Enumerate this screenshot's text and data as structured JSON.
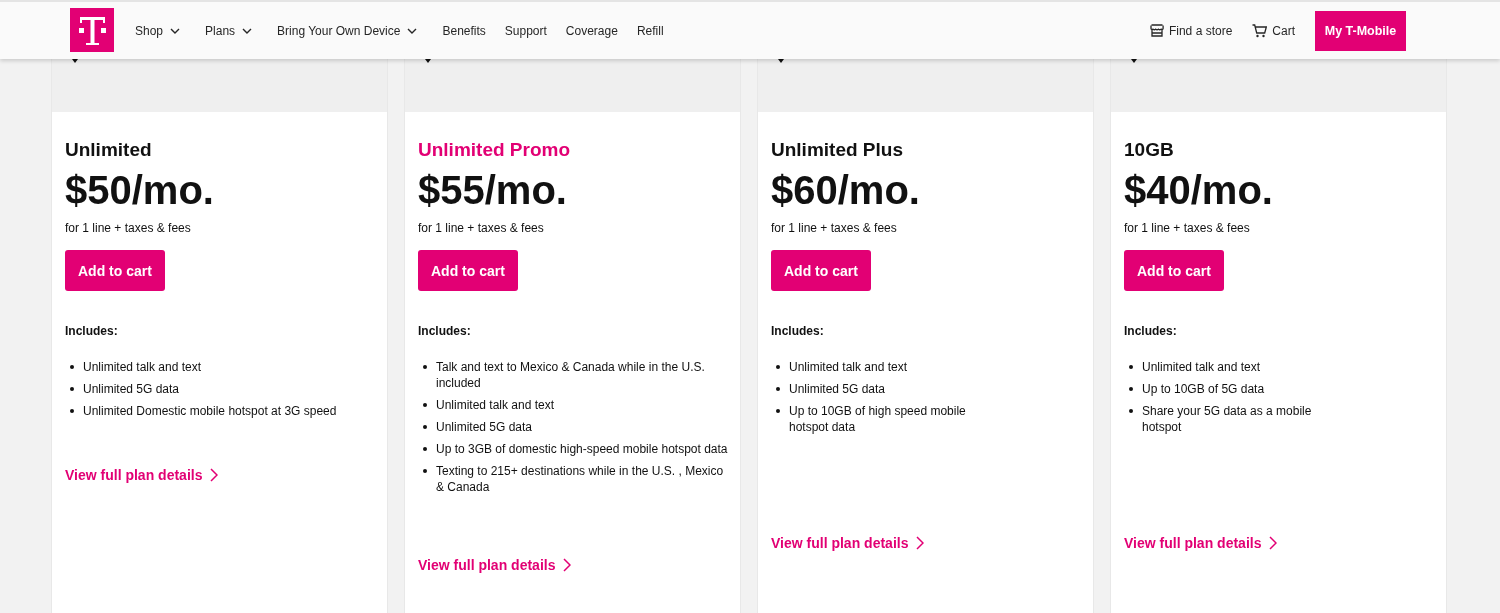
{
  "header": {
    "nav": [
      {
        "label": "Shop",
        "has_menu": true
      },
      {
        "label": "Plans",
        "has_menu": true
      },
      {
        "label": "Bring Your Own Device",
        "has_menu": true
      },
      {
        "label": "Benefits",
        "has_menu": false
      },
      {
        "label": "Support",
        "has_menu": false
      },
      {
        "label": "Coverage",
        "has_menu": false
      },
      {
        "label": "Refill",
        "has_menu": false
      }
    ],
    "utility_links": [
      {
        "kind": "store",
        "label": "Find a store"
      },
      {
        "kind": "cart",
        "label": "Cart"
      }
    ],
    "account_button": "My T-Mobile"
  },
  "plans": [
    {
      "name": "Unlimited",
      "featured": false,
      "price": "$50/mo.",
      "price_note": "for 1 line + taxes & fees",
      "cta": "Add to cart",
      "includes_label": "Includes:",
      "features": [
        "Unlimited talk and text",
        "Unlimited 5G data",
        "Unlimited Domestic mobile hotspot at 3G speed"
      ],
      "details_link": "View full plan details"
    },
    {
      "name": "Unlimited Promo",
      "featured": true,
      "price": "$55/mo.",
      "price_note": "for 1 line + taxes & fees",
      "cta": "Add to cart",
      "includes_label": "Includes:",
      "features": [
        "Talk and text to Mexico & Canada while in the U.S. included",
        "Unlimited talk and text",
        "Unlimited 5G data",
        "Up to 3GB of domestic high-speed mobile hotspot data",
        "Texting to 215+ destinations while in the U.S. , Mexico & Canada"
      ],
      "details_link": "View full plan details"
    },
    {
      "name": "Unlimited Plus",
      "featured": false,
      "price": "$60/mo.",
      "price_note": "for 1 line + taxes & fees",
      "cta": "Add to cart",
      "includes_label": "Includes:",
      "features": [
        "Unlimited talk and text",
        "Unlimited 5G data",
        "Up to 10GB of high speed mobile hotspot data"
      ],
      "details_link": "View full plan details"
    },
    {
      "name": "10GB",
      "featured": false,
      "price": "$40/mo.",
      "price_note": "for 1 line + taxes & fees",
      "cta": "Add to cart",
      "includes_label": "Includes:",
      "features": [
        "Unlimited talk and text",
        "Up to 10GB of 5G data",
        "Share your 5G data as a mobile hotspot"
      ],
      "details_link": "View full plan details"
    }
  ]
}
